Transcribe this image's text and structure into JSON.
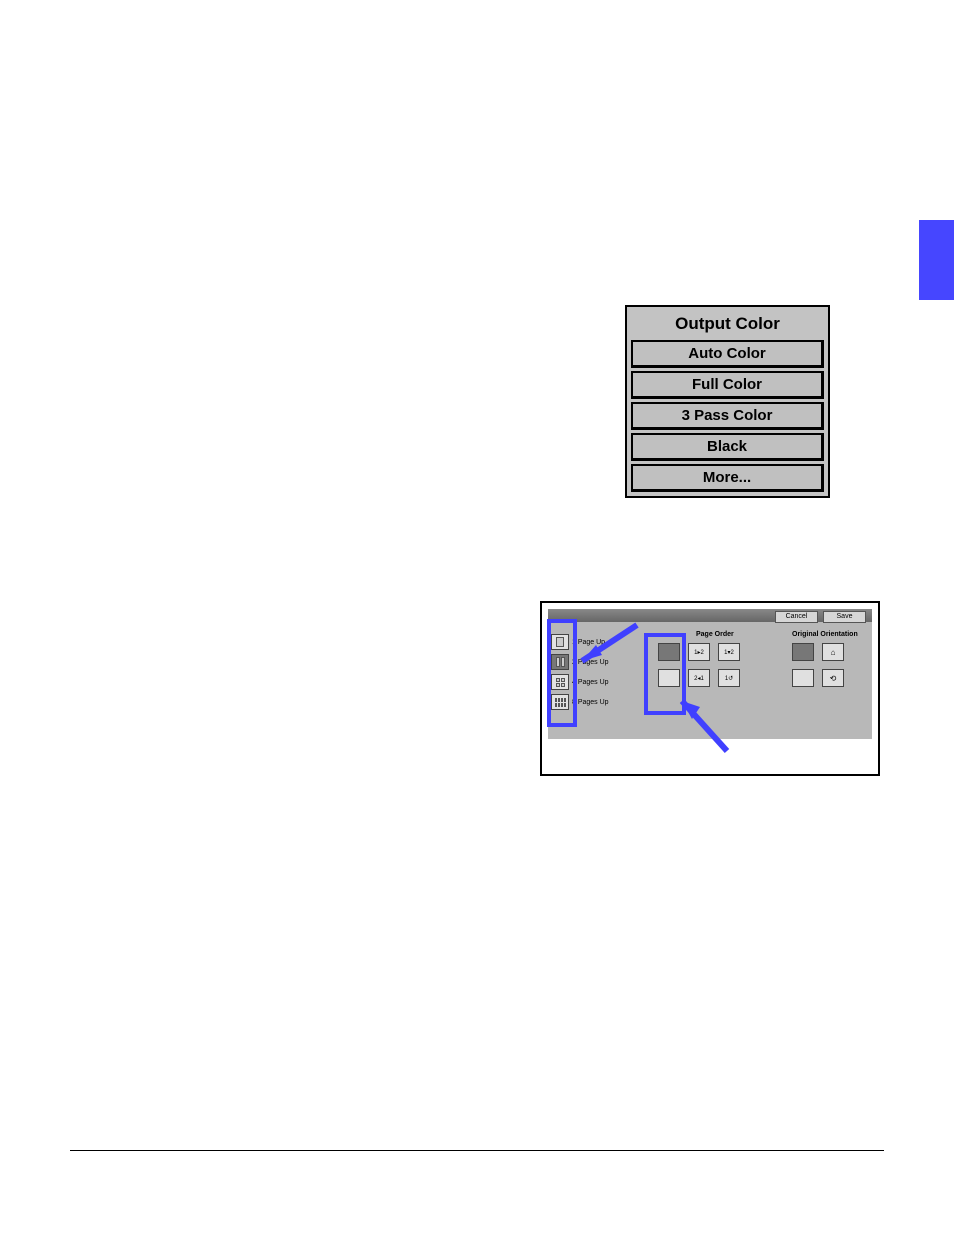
{
  "outputColor": {
    "title": "Output Color",
    "options": [
      "Auto Color",
      "Full Color",
      "3 Pass Color",
      "Black",
      "More..."
    ]
  },
  "multiUp": {
    "toolbar": {
      "cancel": "Cancel",
      "save": "Save"
    },
    "pagesUp": {
      "label": "",
      "options": [
        {
          "label": "1 Page Up",
          "selected": false
        },
        {
          "label": "2 Pages Up",
          "selected": true
        },
        {
          "label": "4 Pages Up",
          "selected": false
        },
        {
          "label": "8 Pages Up",
          "selected": false
        }
      ]
    },
    "pageOrder": {
      "label": "Page Order",
      "selectedIndex": 0
    },
    "orientation": {
      "label": "Original Orientation",
      "selectedIndex": 0
    }
  }
}
